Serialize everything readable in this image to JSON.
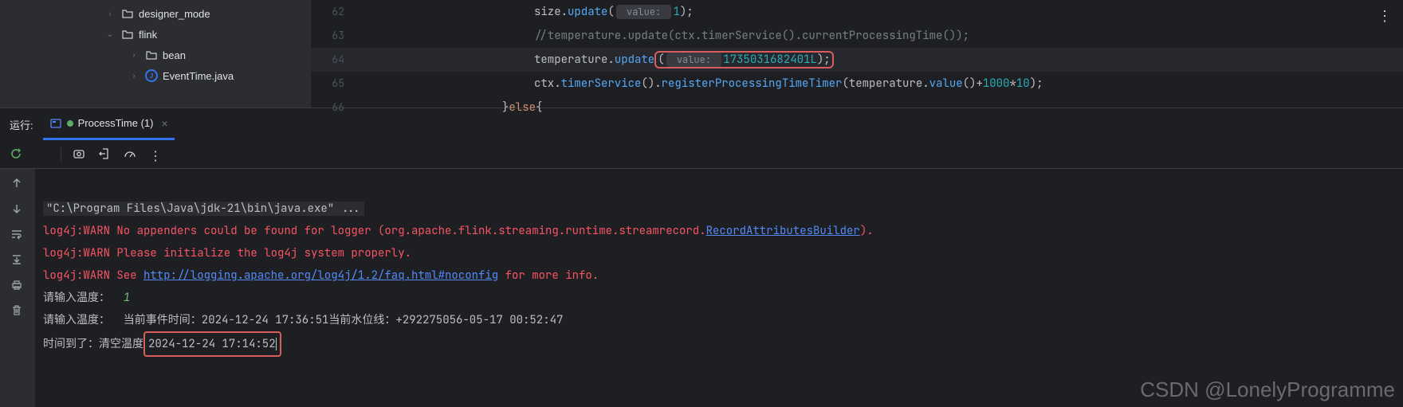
{
  "sidebar": {
    "items": [
      {
        "indent": 130,
        "chevron": "›",
        "icon": "folder",
        "label": "designer_mode"
      },
      {
        "indent": 130,
        "chevron": "⌄",
        "icon": "folder",
        "label": "flink"
      },
      {
        "indent": 160,
        "chevron": "›",
        "icon": "folder",
        "label": "bean"
      },
      {
        "indent": 160,
        "chevron": "›",
        "icon": "java",
        "label": "EventTime.java"
      }
    ]
  },
  "editor": {
    "lines": [
      {
        "n": "62",
        "hl": false,
        "segments": [
          {
            "t": "size",
            "c": ""
          },
          {
            "t": ".",
            "c": ""
          },
          {
            "t": "update",
            "c": "c-method"
          },
          {
            "t": "(",
            "c": ""
          },
          {
            "t": " value: ",
            "c": "c-hint"
          },
          {
            "t": "1",
            "c": "c-num"
          },
          {
            "t": ");",
            "c": ""
          }
        ],
        "indent": 220
      },
      {
        "n": "63",
        "hl": false,
        "segments": [
          {
            "t": "//temperature.update(ctx.timerService().currentProcessingTime());",
            "c": "c-comment"
          }
        ],
        "indent": 220
      },
      {
        "n": "64",
        "hl": true,
        "segments": [
          {
            "t": "temperature",
            "c": ""
          },
          {
            "t": ".",
            "c": ""
          },
          {
            "t": "update",
            "c": "c-method"
          },
          {
            "box_start": true
          },
          {
            "t": "(",
            "c": ""
          },
          {
            "t": " value: ",
            "c": "c-hint"
          },
          {
            "t": "1735031682401L",
            "c": "c-num"
          },
          {
            "t": ");",
            "c": ""
          },
          {
            "box_end": true
          }
        ],
        "indent": 220
      },
      {
        "n": "65",
        "hl": false,
        "segments": [
          {
            "t": "ctx",
            "c": ""
          },
          {
            "t": ".",
            "c": ""
          },
          {
            "t": "timerService",
            "c": "c-method"
          },
          {
            "t": "().",
            "c": ""
          },
          {
            "t": "registerProcessingTimeTimer",
            "c": "c-method"
          },
          {
            "t": "(",
            "c": ""
          },
          {
            "t": "temperature",
            "c": ""
          },
          {
            "t": ".",
            "c": ""
          },
          {
            "t": "value",
            "c": "c-method"
          },
          {
            "t": "()+",
            "c": ""
          },
          {
            "t": "1000",
            "c": "c-num"
          },
          {
            "t": "*",
            "c": ""
          },
          {
            "t": "10",
            "c": "c-num"
          },
          {
            "t": ");",
            "c": ""
          }
        ],
        "indent": 220
      },
      {
        "n": "66",
        "hl": false,
        "segments": [
          {
            "t": "}",
            "c": ""
          },
          {
            "t": "else",
            "c": "c-kw"
          },
          {
            "t": "{",
            "c": ""
          }
        ],
        "indent": 180
      }
    ]
  },
  "run": {
    "label": "运行:",
    "tab_label": "ProcessTime (1)",
    "console": {
      "cmd": "\"C:\\Program Files\\Java\\jdk-21\\bin\\java.exe\" ...",
      "warn1_prefix": "log4j:WARN No appenders could be found for logger (org.apache.flink.streaming.runtime.streamrecord.",
      "warn1_link": "RecordAttributesBuilder",
      "warn1_suffix": ").",
      "warn2": "log4j:WARN Please initialize the log4j system properly.",
      "warn3_prefix": "log4j:WARN See ",
      "warn3_link": "http://logging.apache.org/log4j/1.2/faq.html#noconfig",
      "warn3_suffix": " for more info.",
      "line4_a": "请输入温度：  ",
      "line4_b": "1",
      "line5": "请输入温度：  当前事件时间：2024-12-24 17:36:51当前水位线：+292275056-05-17 00:52:47",
      "line6_a": "时间到了：清空温度",
      "line6_b": "2024-12-24 17:14:52"
    }
  },
  "watermark": "CSDN @LonelyProgramme"
}
